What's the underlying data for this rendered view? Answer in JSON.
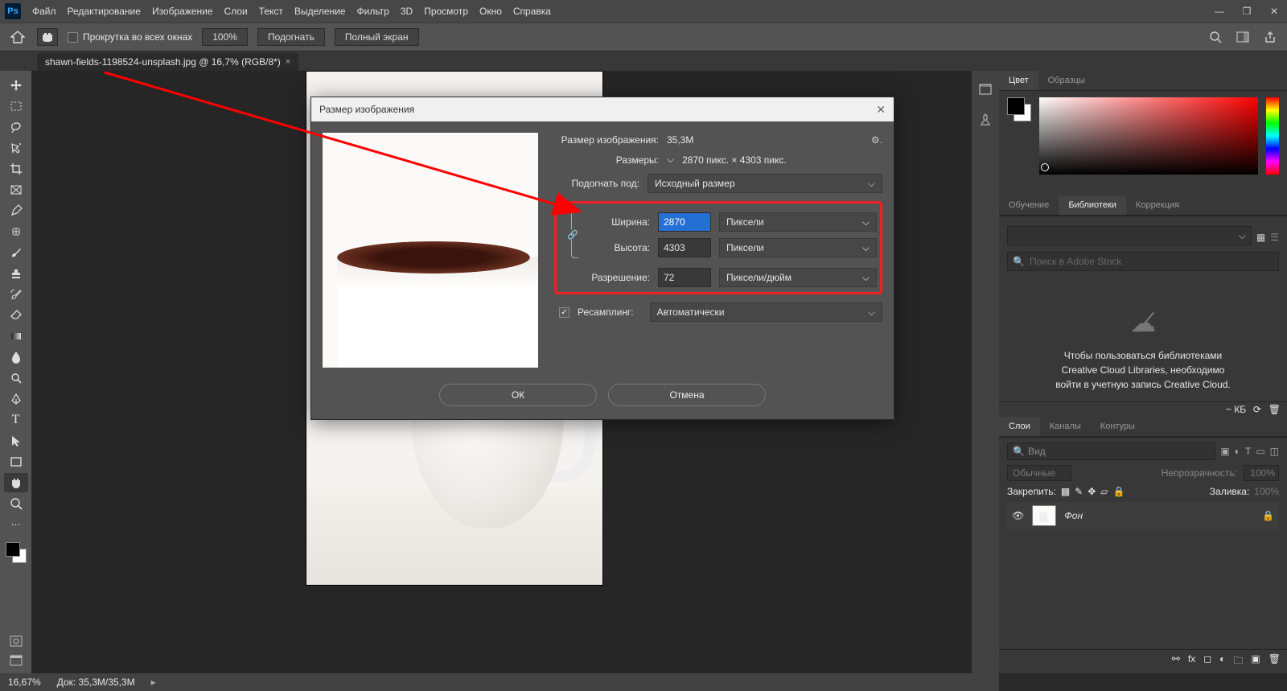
{
  "menu": [
    "Файл",
    "Редактирование",
    "Изображение",
    "Слои",
    "Текст",
    "Выделение",
    "Фильтр",
    "3D",
    "Просмотр",
    "Окно",
    "Справка"
  ],
  "options": {
    "scroll_all": "Прокрутка во всех окнах",
    "zoom": "100%",
    "fit": "Подогнать",
    "fullscreen": "Полный экран"
  },
  "document_tab": "shawn-fields-1198524-unsplash.jpg @ 16,7% (RGB/8*)",
  "status": {
    "zoom": "16,67%",
    "doc": "Док: 35,3M/35,3M"
  },
  "panels": {
    "color_tabs": [
      "Цвет",
      "Образцы"
    ],
    "lib_tabs": [
      "Обучение",
      "Библиотеки",
      "Коррекция"
    ],
    "lib_search_placeholder": "Поиск в Adobe Stock",
    "lib_msg_l1": "Чтобы пользоваться библиотеками",
    "lib_msg_l2": "Creative Cloud Libraries, необходимо",
    "lib_msg_l3": "войти в учетную запись Creative Cloud.",
    "kb": "~ КБ",
    "layer_tabs": [
      "Слои",
      "Каналы",
      "Контуры"
    ],
    "layer_search_placeholder": "Вид",
    "blend": "Обычные",
    "opacity_label": "Непрозрачность:",
    "opacity_val": "100%",
    "lock_label": "Закрепить:",
    "fill_label": "Заливка:",
    "fill_val": "100%",
    "layer_name": "Фон"
  },
  "dialog": {
    "title": "Размер изображения",
    "size_label": "Размер изображения:",
    "size_value": "35,3M",
    "dims_label": "Размеры:",
    "dims_value": "2870 пикс. × 4303 пикс.",
    "fit_label": "Подогнать под:",
    "fit_value": "Исходный размер",
    "width_label": "Ширина:",
    "width_value": "2870",
    "height_label": "Высота:",
    "height_value": "4303",
    "px_unit": "Пиксели",
    "res_label": "Разрешение:",
    "res_value": "72",
    "res_unit": "Пиксели/дюйм",
    "resample_label": "Ресамплинг:",
    "resample_value": "Автоматически",
    "ok": "ОК",
    "cancel": "Отмена"
  }
}
